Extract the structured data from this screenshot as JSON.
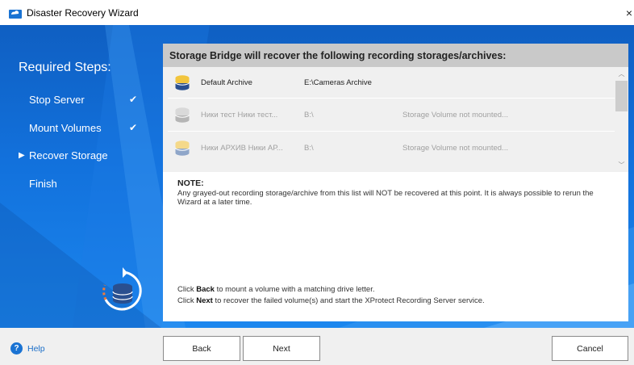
{
  "window": {
    "title": "Disaster Recovery Wizard",
    "close_glyph": "×"
  },
  "sidebar": {
    "title": "Required Steps:",
    "steps": [
      {
        "label": "Stop Server",
        "done": true,
        "current": false
      },
      {
        "label": "Mount Volumes",
        "done": true,
        "current": false
      },
      {
        "label": "Recover Storage",
        "done": false,
        "current": true
      },
      {
        "label": "Finish",
        "done": false,
        "current": false
      }
    ],
    "check_glyph": "✔",
    "current_glyph": "▶"
  },
  "panel": {
    "header": "Storage Bridge will recover the following recording storages/archives:",
    "storages": [
      {
        "name": "Default Archive",
        "path": "E:\\Cameras Archive",
        "status": "",
        "grayed": false
      },
      {
        "name": "Ники тест Ники тест...",
        "path": "B:\\",
        "status": "Storage Volume not mounted...",
        "grayed": true
      },
      {
        "name": "Ники АРХИВ Ники АР...",
        "path": "B:\\",
        "status": "Storage Volume not mounted...",
        "grayed": true
      }
    ],
    "note_title": "NOTE:",
    "note_text": "Any grayed-out recording storage/archive from this list will NOT be recovered at this point. It is always possible to rerun the Wizard at a later time.",
    "hint_back": {
      "prefix": "Click",
      "keyword": "Back",
      "suffix": "to mount a volume with a matching drive letter."
    },
    "hint_next": {
      "prefix": "Click",
      "keyword": "Next",
      "suffix": "to recover the failed volume(s) and start the XProtect Recording Server service."
    }
  },
  "footer": {
    "help_label": "Help",
    "back_label": "Back",
    "next_label": "Next",
    "cancel_label": "Cancel"
  },
  "icons": {
    "app": "cloud-computer-icon",
    "help": "question-circle-icon",
    "storage": "database-icon",
    "graphic": "database-restore-icon"
  },
  "colors": {
    "accent_blue": "#1271dc",
    "header_gray": "#c9c9c9",
    "list_bg": "#f0f0f0"
  }
}
